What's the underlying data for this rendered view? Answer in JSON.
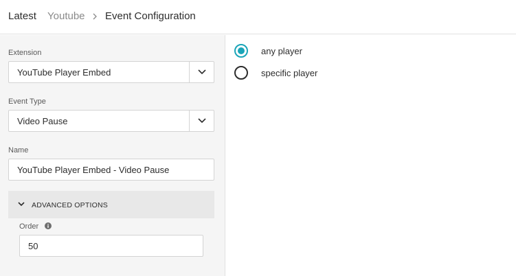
{
  "breadcrumb": {
    "items": [
      "Latest",
      "Youtube"
    ],
    "current": "Event Configuration"
  },
  "form": {
    "extension": {
      "label": "Extension",
      "value": "YouTube Player Embed"
    },
    "event_type": {
      "label": "Event Type",
      "value": "Video Pause"
    },
    "name": {
      "label": "Name",
      "value": "YouTube Player Embed - Video Pause"
    },
    "advanced": {
      "label": "ADVANCED OPTIONS",
      "expanded": true
    },
    "order": {
      "label": "Order",
      "value": "50"
    }
  },
  "player_options": [
    {
      "label": "any player",
      "checked": true
    },
    {
      "label": "specific player",
      "checked": false
    }
  ],
  "colors": {
    "accent": "#1aa5b8",
    "sidebar_bg": "#f5f5f5",
    "advanced_bg": "#e8e8e8"
  },
  "icons": [
    "chevron-right-icon",
    "chevron-down-icon",
    "info-icon"
  ]
}
